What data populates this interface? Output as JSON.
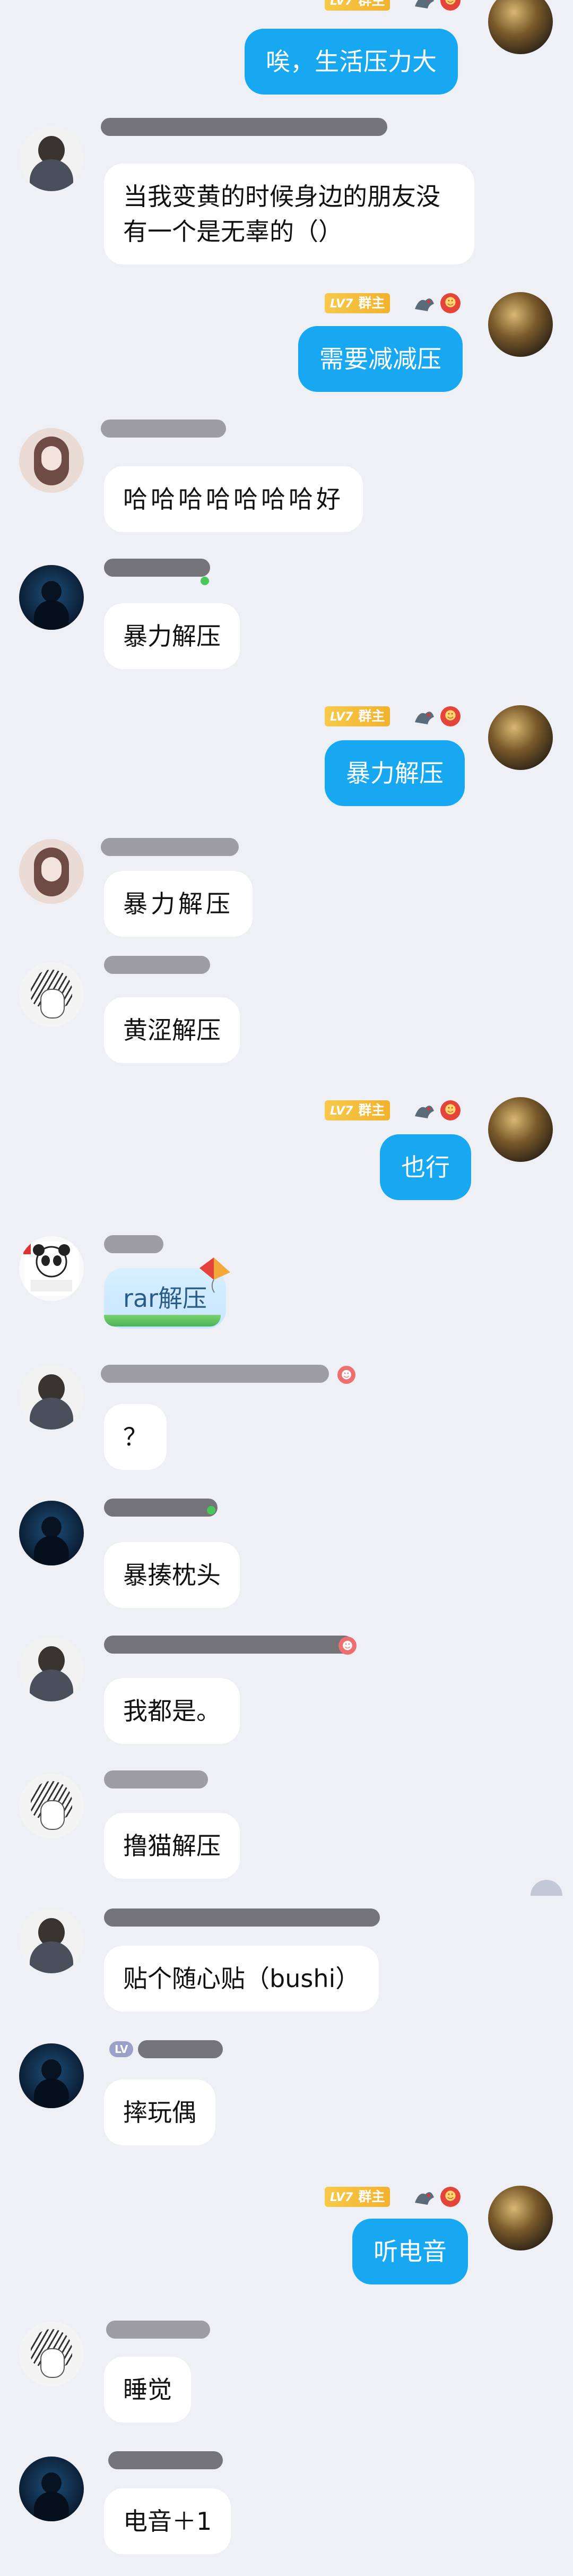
{
  "owner": {
    "level": "LV7",
    "role": "群主",
    "icon_names": [
      "dragon-icon",
      "red-medal-icon"
    ]
  },
  "messages": [
    {
      "side": "right",
      "text": "唉，生活压力大",
      "avatar": "avatar-owner"
    },
    {
      "side": "left",
      "text": "当我变黄的时候身边的朋友没有一个是无辜的（）",
      "avatar": "avatar-suit"
    },
    {
      "side": "right",
      "text": "需要减减压",
      "avatar": "avatar-owner"
    },
    {
      "side": "left",
      "text": "哈哈哈哈哈哈哈好",
      "avatar": "avatar-girl"
    },
    {
      "side": "left",
      "text": "暴力解压",
      "avatar": "avatar-blue"
    },
    {
      "side": "right",
      "text": "暴力解压",
      "avatar": "avatar-owner"
    },
    {
      "side": "left",
      "text": "暴力解压",
      "avatar": "avatar-girl"
    },
    {
      "side": "left",
      "text": "黄涩解压",
      "avatar": "avatar-sketch"
    },
    {
      "side": "right",
      "text": "也行",
      "avatar": "avatar-owner"
    },
    {
      "side": "left",
      "text": "rar解压",
      "avatar": "avatar-panda"
    },
    {
      "side": "left",
      "text": "？",
      "avatar": "avatar-suit"
    },
    {
      "side": "left",
      "text": "暴揍枕头",
      "avatar": "avatar-blue"
    },
    {
      "side": "left",
      "text": "我都是。",
      "avatar": "avatar-suit"
    },
    {
      "side": "left",
      "text": "撸猫解压",
      "avatar": "avatar-sketch"
    },
    {
      "side": "left",
      "text": "贴个随心贴（bushi）",
      "avatar": "avatar-suit"
    },
    {
      "side": "left",
      "text": "摔玩偶",
      "avatar": "avatar-blue"
    },
    {
      "side": "right",
      "text": "听电音",
      "avatar": "avatar-owner"
    },
    {
      "side": "left",
      "text": "睡觉",
      "avatar": "avatar-sketch"
    },
    {
      "side": "left",
      "text": "电音＋1",
      "avatar": "avatar-blue"
    }
  ],
  "member_levels": {
    "lv_pill": "LV"
  },
  "colors": {
    "background": "#eef0f6",
    "outgoing_bubble": "#18a8f2",
    "incoming_bubble": "#ffffff",
    "level_badge": "#f2b22e"
  }
}
